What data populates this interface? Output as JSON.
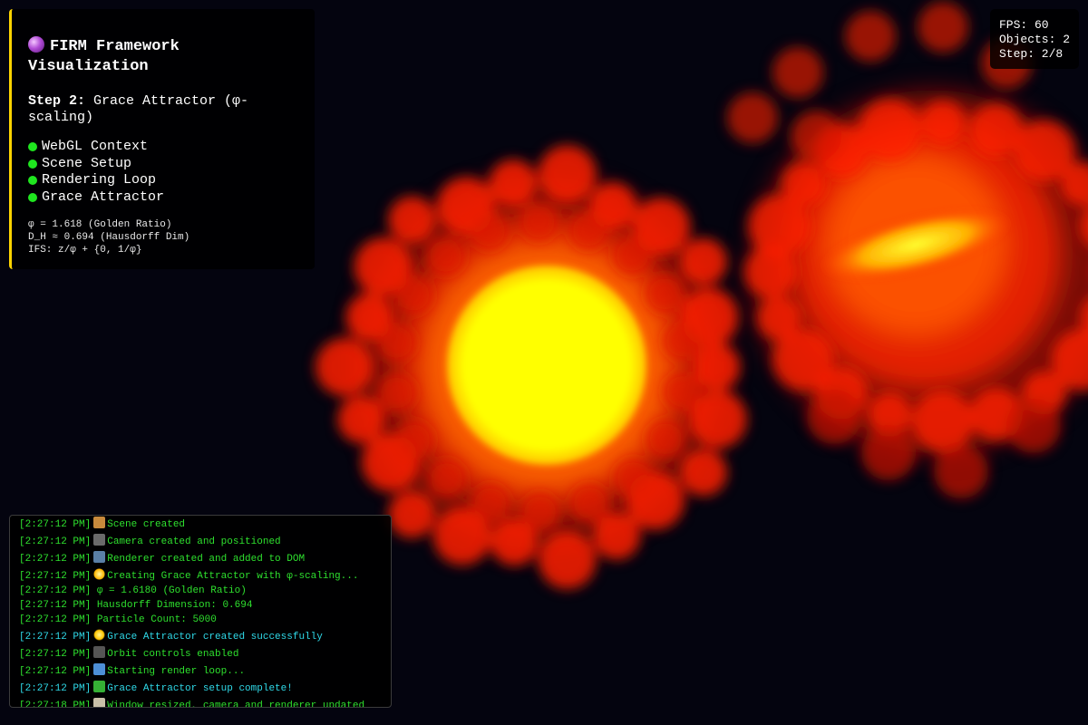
{
  "info_panel": {
    "title": "FIRM Framework Visualization",
    "step_label": "Step 2:",
    "step_name": "Grace Attractor (φ-scaling)",
    "status_items": [
      {
        "label": "WebGL Context",
        "status_color": "#1fe61f"
      },
      {
        "label": "Scene Setup",
        "status_color": "#1fe61f"
      },
      {
        "label": "Rendering Loop",
        "status_color": "#1fe61f"
      },
      {
        "label": "Grace Attractor",
        "status_color": "#1fe61f"
      }
    ],
    "math_lines": [
      "φ = 1.618 (Golden Ratio)",
      "D_H ≈ 0.694 (Hausdorff Dim)",
      "IFS: z/φ + {0, 1/φ}"
    ]
  },
  "stats": {
    "fps": "FPS: 60",
    "objects": "Objects: 2",
    "step": "Step: 2/8"
  },
  "console": {
    "lines": [
      {
        "time": "[2:27:12 PM]",
        "icon": "package-icon",
        "text": "Scene created",
        "highlight": false
      },
      {
        "time": "[2:27:12 PM]",
        "icon": "camera-icon",
        "text": "Camera created and positioned",
        "highlight": false
      },
      {
        "time": "[2:27:12 PM]",
        "icon": "monitor-icon",
        "text": "Renderer created and added to DOM",
        "highlight": false
      },
      {
        "time": "[2:27:12 PM]",
        "icon": "sparkle-star-icon",
        "text": "Creating Grace Attractor with φ-scaling...",
        "highlight": false
      },
      {
        "time": "[2:27:12 PM]",
        "icon": "",
        "text": "φ = 1.6180 (Golden Ratio)",
        "highlight": false
      },
      {
        "time": "[2:27:12 PM]",
        "icon": "",
        "text": "Hausdorff Dimension: 0.694",
        "highlight": false
      },
      {
        "time": "[2:27:12 PM]",
        "icon": "",
        "text": "Particle Count: 5000",
        "highlight": false
      },
      {
        "time": "[2:27:12 PM]",
        "icon": "sparkles-icon",
        "text": "Grace Attractor created successfully",
        "highlight": true
      },
      {
        "time": "[2:27:12 PM]",
        "icon": "gamepad-icon",
        "text": "Orbit controls enabled",
        "highlight": false
      },
      {
        "time": "[2:27:12 PM]",
        "icon": "refresh-icon",
        "text": "Starting render loop...",
        "highlight": false
      },
      {
        "time": "[2:27:12 PM]",
        "icon": "check-icon",
        "text": "Grace Attractor setup complete!",
        "highlight": true
      },
      {
        "time": "[2:27:18 PM]",
        "icon": "ruler-icon",
        "text": "Window resized, camera and renderer updated",
        "highlight": false
      }
    ]
  },
  "colors": {
    "background": "#04040f",
    "accent": "#ffd400",
    "log_green": "#2ee02e",
    "log_cyan": "#2fd9e8",
    "status_green": "#1fe61f",
    "core_yellow": "#ffff00",
    "glow_red": "#ff2a00"
  }
}
